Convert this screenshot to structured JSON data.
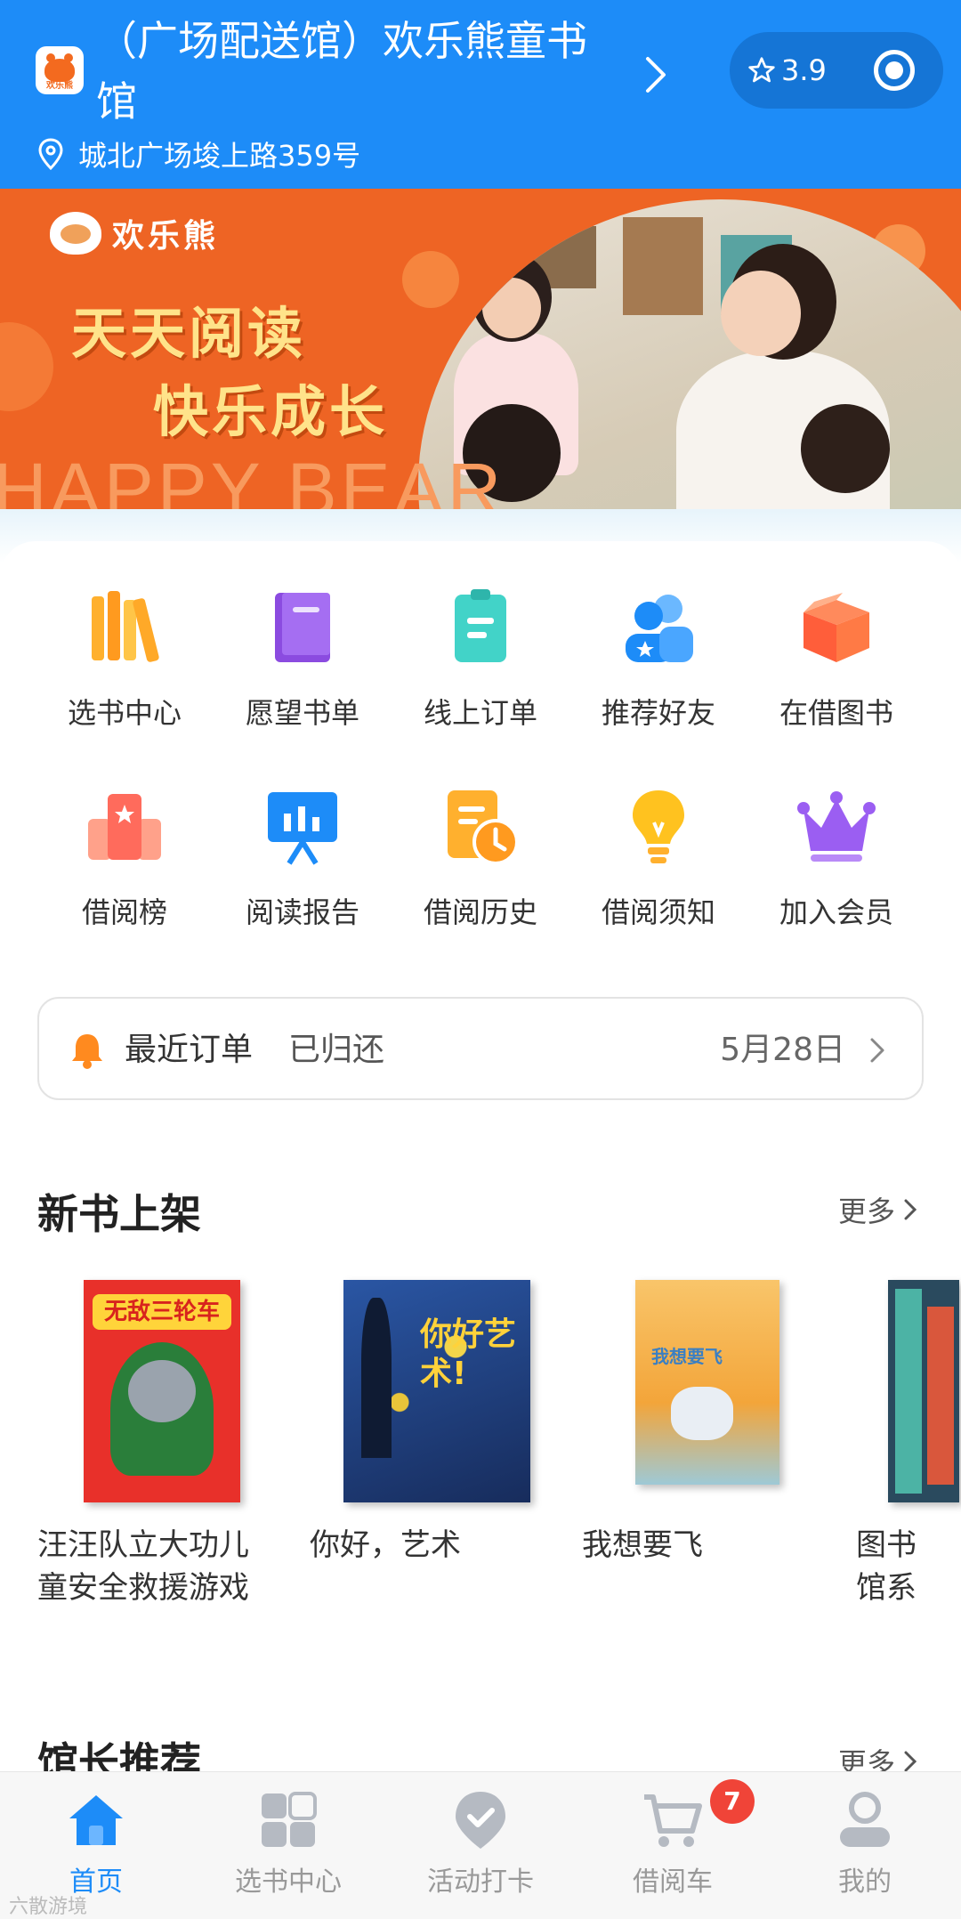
{
  "header": {
    "logo_text": "欢乐熊",
    "store_name": "（广场配送馆）欢乐熊童书馆",
    "address": "城北广场埈上路359号",
    "rating": "3.9"
  },
  "banner": {
    "brand": "欢乐熊",
    "slogan_line1": "天天阅读",
    "slogan_line2": "快乐成长",
    "watermark": "HAPPY BEAR"
  },
  "features": [
    {
      "label": "选书中心",
      "icon": "books-icon"
    },
    {
      "label": "愿望书单",
      "icon": "book-icon"
    },
    {
      "label": "线上订单",
      "icon": "clipboard-icon"
    },
    {
      "label": "推荐好友",
      "icon": "friends-icon"
    },
    {
      "label": "在借图书",
      "icon": "box-icon"
    },
    {
      "label": "借阅榜",
      "icon": "ranking-icon"
    },
    {
      "label": "阅读报告",
      "icon": "report-board-icon"
    },
    {
      "label": "借阅历史",
      "icon": "history-clock-icon"
    },
    {
      "label": "借阅须知",
      "icon": "lightbulb-icon"
    },
    {
      "label": "加入会员",
      "icon": "crown-icon"
    }
  ],
  "recent_order": {
    "label": "最近订单",
    "status": "已归还",
    "date": "5月28日"
  },
  "new_books": {
    "title": "新书上架",
    "more": "更多",
    "items": [
      {
        "title": "汪汪队立大功儿童安全救援游戏",
        "cover_text": "无敌三轮车"
      },
      {
        "title": "你好，艺术",
        "cover_text": "你好艺术!"
      },
      {
        "title": "我想要飞",
        "cover_text": "我想要飞"
      },
      {
        "title": "图书馆系列",
        "cover_text": ""
      }
    ]
  },
  "curator_picks": {
    "title": "馆长推荐",
    "more": "更多"
  },
  "tabbar": {
    "tabs": [
      {
        "label": "首页",
        "icon": "home-icon"
      },
      {
        "label": "选书中心",
        "icon": "grid-icon"
      },
      {
        "label": "活动打卡",
        "icon": "checkin-icon"
      },
      {
        "label": "借阅车",
        "icon": "cart-icon"
      },
      {
        "label": "我的",
        "icon": "profile-icon"
      }
    ],
    "cart_badge": "7"
  },
  "footer_watermark": "六散游境",
  "colors": {
    "primary": "#1d8cf8",
    "banner": "#ee6424",
    "badge": "#f04438"
  }
}
